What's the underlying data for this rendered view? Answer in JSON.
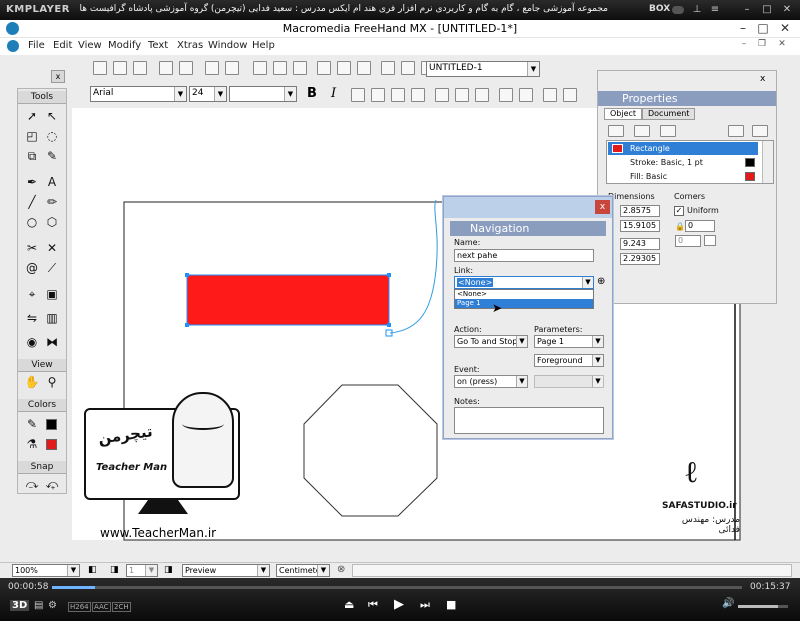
{
  "player": {
    "logo": "KMPLAYER",
    "caption": "مجموعه آموزشی جامع ، گام به گام و کاربردی نرم افزار فری هند ام ایکس   مدرس : سعید فدایی (تیچرمن) گروه آموزشی پادشاه گرافیست ها",
    "box_label": "BOX",
    "time_elapsed": "00:00:58",
    "time_total": "00:15:37",
    "badges": [
      "3D",
      "H264",
      "AAC",
      "2CH"
    ]
  },
  "window": {
    "title": "Macromedia FreeHand MX - [UNTITLED-1*]"
  },
  "menu": [
    "File",
    "Edit",
    "View",
    "Modify",
    "Text",
    "Xtras",
    "Window",
    "Help"
  ],
  "toolbar": {
    "document_select": "UNTITLED-1",
    "font_name": "Arial",
    "font_size": "24"
  },
  "tools": {
    "title": "Tools",
    "view_label": "View",
    "colors_label": "Colors",
    "snap_label": "Snap",
    "close": "x"
  },
  "properties": {
    "title": "Properties",
    "tab_object": "Object",
    "tab_document": "Document",
    "items": [
      "Rectangle",
      "Stroke: Basic, 1 pt",
      "Fill: Basic"
    ],
    "dimensions_label": "Dimensions",
    "corners_label": "Corners",
    "uniform_label": "Uniform",
    "x_value": "2.8575",
    "y_value": "15.9105",
    "w_value": "9.243",
    "h_value": "2.29305",
    "corner_value": "0",
    "corner_value2": "0",
    "close": "x"
  },
  "navigation": {
    "title": "Navigation",
    "close": "x",
    "name_label": "Name:",
    "name_value": "next pahe",
    "link_label": "Link:",
    "link_value": "<None>",
    "link_options": [
      "<None>",
      "Page 1"
    ],
    "action_label": "Action:",
    "action_value": "Go To and Stop",
    "parameters_label": "Parameters:",
    "param1": "Page 1",
    "param2": "Foreground",
    "event_label": "Event:",
    "event_value": "on (press)",
    "notes_label": "Notes:"
  },
  "watermark": {
    "site": "www.TeacherMan.ir",
    "tm_name": "Teacher Man",
    "tm_logo": "تیچرمن",
    "studio": "SAFASTUDIO.ir",
    "teacher_caption": "مدرس: مهندس فدائی"
  },
  "statusbar": {
    "zoom": "100%",
    "page": "1",
    "mode": "Preview",
    "units": "Centimeter"
  },
  "colors": {
    "rect_fill": "#ff1a1a",
    "selection": "#1e90ff"
  }
}
